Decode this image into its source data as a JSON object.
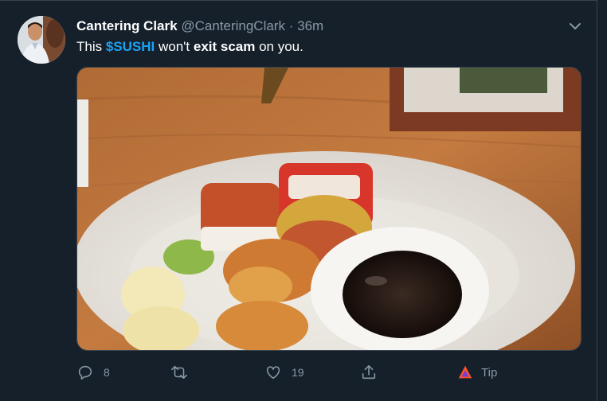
{
  "tweet": {
    "author_name": "Cantering Clark",
    "author_handle": "@CanteringClark",
    "separator": "·",
    "time": "36m",
    "text": {
      "part1": "This ",
      "cashtag": "$SUSHI",
      "part2": " won't ",
      "bold": "exit scam",
      "part3": " on you."
    }
  },
  "actions": {
    "reply_count": "8",
    "retweet_count": "",
    "like_count": "19",
    "tip_label": "Tip"
  },
  "colors": {
    "background": "#15202b",
    "accent": "#1da1f2",
    "muted": "#8899a6",
    "brave": "#fb542b"
  },
  "icons": {
    "reply": "reply-icon",
    "retweet": "retweet-icon",
    "like": "heart-icon",
    "share": "share-icon",
    "tip": "brave-tip-icon",
    "menu": "chevron-down-icon"
  }
}
